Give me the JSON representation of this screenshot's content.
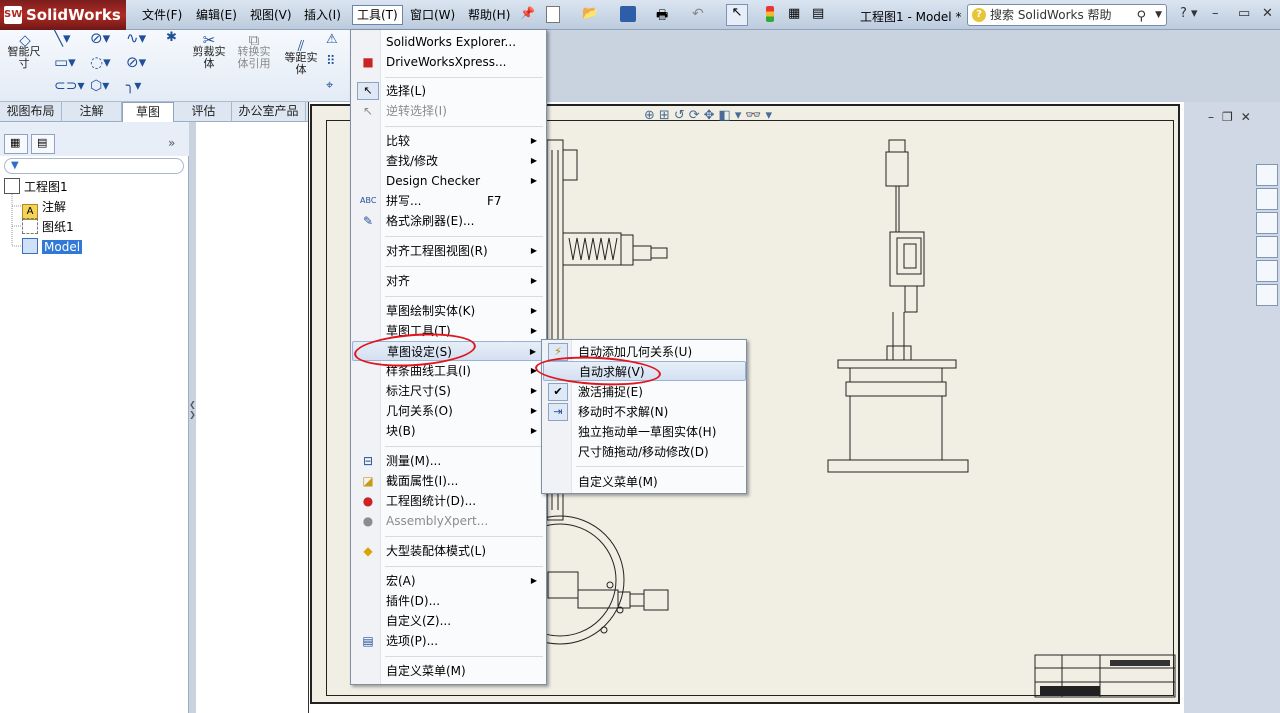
{
  "app": {
    "name": "SolidWorks",
    "logo_mark": "SW"
  },
  "menubar": [
    {
      "label": "文件(F)"
    },
    {
      "label": "编辑(E)"
    },
    {
      "label": "视图(V)"
    },
    {
      "label": "插入(I)"
    },
    {
      "label": "工具(T)"
    },
    {
      "label": "窗口(W)"
    },
    {
      "label": "帮助(H)"
    }
  ],
  "window_title": "工程图1 - Model *",
  "search": {
    "placeholder": "搜索 SolidWorks 帮助"
  },
  "command_manager": {
    "smart_dimension": "智能尺寸",
    "trim": "剪裁实体",
    "convert": "转换实体引用",
    "offset": "等距实体"
  },
  "cmd_tabs": [
    {
      "label": "视图布局"
    },
    {
      "label": "注解"
    },
    {
      "label": "草图"
    },
    {
      "label": "评估"
    },
    {
      "label": "办公室产品"
    }
  ],
  "feature_tree": {
    "root": "工程图1",
    "items": [
      {
        "label": "注解"
      },
      {
        "label": "图纸1"
      },
      {
        "label": "Model"
      }
    ]
  },
  "tools_menu": {
    "items": [
      {
        "label": "SolidWorks Explorer..."
      },
      {
        "label": "DriveWorksXpress..."
      },
      {
        "label": "选择(L)"
      },
      {
        "label": "逆转选择(I)"
      },
      {
        "label": "比较"
      },
      {
        "label": "查找/修改"
      },
      {
        "label": "Design Checker"
      },
      {
        "label": "拼写...",
        "shortcut": "F7"
      },
      {
        "label": "格式涂刷器(E)..."
      },
      {
        "label": "对齐工程图视图(R)"
      },
      {
        "label": "对齐"
      },
      {
        "label": "草图绘制实体(K)"
      },
      {
        "label": "草图工具(T)"
      },
      {
        "label": "草图设定(S)"
      },
      {
        "label": "样条曲线工具(I)"
      },
      {
        "label": "标注尺寸(S)"
      },
      {
        "label": "几何关系(O)"
      },
      {
        "label": "块(B)"
      },
      {
        "label": "测量(M)..."
      },
      {
        "label": "截面属性(I)..."
      },
      {
        "label": "工程图统计(D)..."
      },
      {
        "label": "AssemblyXpert..."
      },
      {
        "label": "大型装配体模式(L)"
      },
      {
        "label": "宏(A)"
      },
      {
        "label": "插件(D)..."
      },
      {
        "label": "自定义(Z)..."
      },
      {
        "label": "选项(P)..."
      },
      {
        "label": "自定义菜单(M)"
      }
    ]
  },
  "sketch_settings_submenu": {
    "items": [
      {
        "label": "自动添加几何关系(U)"
      },
      {
        "label": "自动求解(V)"
      },
      {
        "label": "激活捕捉(E)"
      },
      {
        "label": "移动时不求解(N)"
      },
      {
        "label": "独立拖动单一草图实体(H)"
      },
      {
        "label": "尺寸随拖动/移动修改(D)"
      },
      {
        "label": "自定义菜单(M)"
      }
    ]
  },
  "colors": {
    "annotation_red": "#e0161c",
    "highlight": "#3179d6",
    "sheet": "#f1efe4"
  }
}
